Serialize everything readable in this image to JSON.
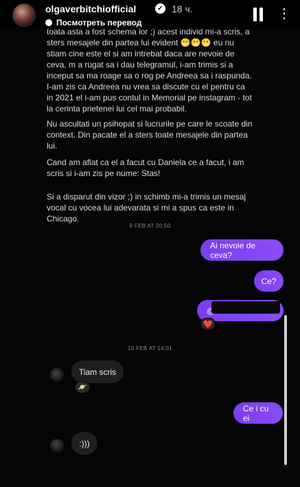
{
  "header": {
    "username": "olgaverbitchiofficial",
    "time": "18 ч.",
    "translate_label": "Посмотреть перевод",
    "verified_icon": "verified-badge-icon",
    "pause_icon": "pause-icon",
    "more_icon": "more-dots-icon"
  },
  "message": {
    "p1": "toata asta a fost schema lor ;) acest individ mi-a scris, a sters mesajele din partea lui evident 😬😬😬 eu nu stiam cine este el si am intrebat daca are nevoie de ceva, m a rugat sa i dau telegramul, i-am trimis si a inceput sa ma roage sa o rog pe Andreea sa i raspunda. I-am zis ca Andreea nu vrea sa discute cu el pentru ca in 2021 el i-am pus contul in Memorial pe instagram - tot la cerinta prietenei lui cel mai probabil.",
    "p2": "Nu ascultati un psihopat si lucrurile pe care le scoate din context. Din pacate el a sters toate mesajele din partea lui.",
    "p3": "Cand am aflat ca el a facut cu Daniela ce a facut, i am scris si i-am zis pe nume: Stas!",
    "p4": "Si a disparut din vizor ;) in schimb mi-a trimis un mesaj vocal cu vocea lui adevarata si mi a spus ca este in Chicago."
  },
  "chat": {
    "ts1": "9 FEB AT 20:50",
    "out1": "Ai nevoie de ceva?",
    "out2": "Ce?",
    "out3": "@",
    "reaction1": "❤️",
    "ts2": "10 FEB AT 14:01",
    "in1": "Tiam scris",
    "reaction2": "🪐",
    "out4": "Ce i cu ei",
    "in2": ":)))"
  },
  "colors": {
    "outgoing_bubble": "#8a4cf7",
    "incoming_bubble": "#1f1f1f",
    "background": "#050505"
  }
}
